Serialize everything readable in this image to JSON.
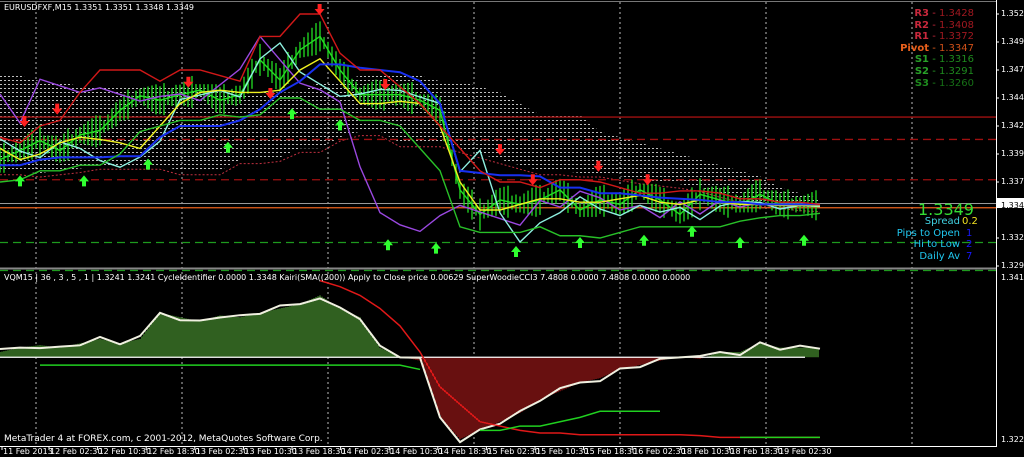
{
  "header": {
    "symbol_line": "EURUSDFXF,M15  1.3351 1.3351 1.3348 1.3349"
  },
  "sub_header": {
    "indicator_line": "VQM15 | 36 , 3 , 5 , 1  |  1.3241 1.3241  CycleIdentifier 0.0000 1.3348  Kairi(SMA((200)) Apply to Close price 0.00629  SuperWoodieCCI3 7.4808 0.0000 7.4808 0.0000 0.0000"
  },
  "footer": {
    "copyright": "MetaTrader 4 at FOREX.com, c 2001-2012, MetaQuotes Software Corp."
  },
  "pivots": [
    {
      "label": "R3",
      "value": "1.3428",
      "color": "#c8283c",
      "vcolor": "#a01820"
    },
    {
      "label": "R2",
      "value": "1.3408",
      "color": "#c8283c",
      "vcolor": "#a01820"
    },
    {
      "label": "R1",
      "value": "1.3372",
      "color": "#c8283c",
      "vcolor": "#a01820"
    },
    {
      "label": "Pivot",
      "value": "1.3347",
      "color": "#e8601c",
      "vcolor": "#d05018"
    },
    {
      "label": "S1",
      "value": "1.3316",
      "color": "#28a028",
      "vcolor": "#1e8a1e"
    },
    {
      "label": "S2",
      "value": "1.3291",
      "color": "#28a028",
      "vcolor": "#1e8a1e"
    },
    {
      "label": "S3",
      "value": "1.3260",
      "color": "#1e8a1e",
      "vcolor": "#167016"
    }
  ],
  "info": {
    "price": "1.3349",
    "spread_label": "Spread",
    "spread_value": "0.2",
    "pips_label": "Pips to Open",
    "pips_value": "1",
    "hilo_label": "Hi to Low",
    "hilo_value": "2",
    "daily_label": "Daily Av",
    "daily_value": "7"
  },
  "chart_data": {
    "type": "line",
    "title": "EURUSDFXF,M15",
    "main_axis": {
      "ylim": [
        1.3283,
        1.3532
      ],
      "ticks": [
        "1.3520",
        "1.3495",
        "1.3470",
        "1.3445",
        "1.3420",
        "1.3395",
        "1.3370",
        "1.3349",
        "1.3320",
        "1.3295"
      ],
      "current": "1.3349"
    },
    "sub_axis": {
      "ylim": [
        1.3222,
        1.3424
      ],
      "ticks": [
        "1.3415",
        "1.3229"
      ]
    },
    "x_step_bars": 13,
    "time_labels": [
      "11 Feb 2013",
      "12 Feb 02:30",
      "12 Feb 10:30",
      "12 Feb 18:30",
      "13 Feb 02:30",
      "13 Feb 10:30",
      "13 Feb 18:30",
      "14 Feb 02:30",
      "14 Feb 10:30",
      "14 Feb 18:30",
      "15 Feb 02:30",
      "15 Feb 10:30",
      "15 Feb 18:30",
      "16 Feb 02:30",
      "18 Feb 10:30",
      "18 Feb 18:30",
      "19 Feb 02:30"
    ],
    "series": [
      {
        "name": "price",
        "color": "#22dd22",
        "values": [
          1.339,
          1.3398,
          1.3407,
          1.3398,
          1.3412,
          1.3416,
          1.3434,
          1.3447,
          1.3443,
          1.3448,
          1.3452,
          1.3443,
          1.3448,
          1.3479,
          1.3461,
          1.3488,
          1.35,
          1.347,
          1.3448,
          1.3448,
          1.3448,
          1.3443,
          1.3434,
          1.3363,
          1.3341,
          1.3354,
          1.335,
          1.3354,
          1.3363,
          1.3345,
          1.3354,
          1.335,
          1.3363,
          1.3354,
          1.3341,
          1.3359,
          1.3354,
          1.335,
          1.3359,
          1.335,
          1.335,
          1.3349
        ]
      },
      {
        "name": "purple",
        "color": "#9a48e0",
        "values": [
          1.3445,
          1.342,
          1.346,
          1.3455,
          1.345,
          1.3455,
          1.345,
          1.3445,
          1.345,
          1.3445,
          1.344,
          1.3455,
          1.347,
          1.35,
          1.348,
          1.346,
          1.3455,
          1.3445,
          1.338,
          1.334,
          1.333,
          1.3325,
          1.334,
          1.335,
          1.3345,
          1.334,
          1.3335,
          1.335,
          1.3345,
          1.336,
          1.3355,
          1.3345,
          1.335,
          1.334,
          1.3355,
          1.3345,
          1.335,
          1.3345,
          1.335,
          1.3345,
          1.335,
          1.3349
        ]
      },
      {
        "name": "cyan",
        "color": "#8ef0e0",
        "values": [
          1.3405,
          1.3395,
          1.339,
          1.3405,
          1.34,
          1.339,
          1.3385,
          1.3395,
          1.341,
          1.344,
          1.3445,
          1.345,
          1.3445,
          1.348,
          1.3495,
          1.347,
          1.346,
          1.345,
          1.3445,
          1.345,
          1.345,
          1.3445,
          1.344,
          1.338,
          1.34,
          1.3345,
          1.332,
          1.333,
          1.334,
          1.3355,
          1.3345,
          1.334,
          1.335,
          1.3345,
          1.335,
          1.334,
          1.3345,
          1.335,
          1.335,
          1.3345,
          1.3349,
          1.3349
        ]
      },
      {
        "name": "yellow",
        "color": "#f0f020",
        "values": [
          1.34,
          1.339,
          1.3395,
          1.3405,
          1.341,
          1.3408,
          1.3405,
          1.34,
          1.342,
          1.344,
          1.345,
          1.3452,
          1.345,
          1.345,
          1.3452,
          1.347,
          1.348,
          1.346,
          1.344,
          1.344,
          1.3442,
          1.344,
          1.342,
          1.337,
          1.3345,
          1.3345,
          1.335,
          1.3355,
          1.3355,
          1.3352,
          1.3352,
          1.3355,
          1.3358,
          1.3352,
          1.335,
          1.3354,
          1.3352,
          1.335,
          1.335,
          1.3349,
          1.3349,
          1.3349
        ]
      },
      {
        "name": "blue",
        "color": "#1830f0",
        "values": [
          1.3385,
          1.3385,
          1.339,
          1.3392,
          1.3392,
          1.3392,
          1.3393,
          1.3393,
          1.341,
          1.342,
          1.342,
          1.342,
          1.3425,
          1.3435,
          1.345,
          1.346,
          1.3475,
          1.3475,
          1.3472,
          1.347,
          1.3468,
          1.346,
          1.344,
          1.338,
          1.3378,
          1.3376,
          1.3376,
          1.3375,
          1.3365,
          1.3365,
          1.336,
          1.336,
          1.3358,
          1.3356,
          1.3355,
          1.3354,
          1.3352,
          1.3352,
          1.335,
          1.335,
          1.335,
          1.335
        ]
      },
      {
        "name": "red",
        "color": "#d01818",
        "values": [
          1.341,
          1.3405,
          1.342,
          1.3425,
          1.345,
          1.347,
          1.347,
          1.347,
          1.346,
          1.347,
          1.347,
          1.3465,
          1.346,
          1.35,
          1.35,
          1.352,
          1.352,
          1.3485,
          1.347,
          1.347,
          1.3455,
          1.344,
          1.342,
          1.34,
          1.338,
          1.337,
          1.337,
          1.3365,
          1.3372,
          1.3372,
          1.337,
          1.3365,
          1.336,
          1.336,
          1.3362,
          1.3362,
          1.336,
          1.3355,
          1.3355,
          1.3352,
          1.3352,
          1.335
        ]
      },
      {
        "name": "green-low",
        "color": "#28c028",
        "values": [
          1.337,
          1.3372,
          1.338,
          1.338,
          1.3385,
          1.3385,
          1.3395,
          1.3415,
          1.342,
          1.3425,
          1.3425,
          1.343,
          1.3428,
          1.343,
          1.3445,
          1.3445,
          1.3435,
          1.3435,
          1.3425,
          1.3425,
          1.342,
          1.34,
          1.338,
          1.333,
          1.3325,
          1.3325,
          1.3325,
          1.333,
          1.3322,
          1.3322,
          1.332,
          1.3325,
          1.333,
          1.333,
          1.333,
          1.333,
          1.333,
          1.3335,
          1.3338,
          1.334,
          1.334,
          1.3342
        ]
      }
    ],
    "levels": [
      {
        "name": "R3",
        "price": 1.3428,
        "color": "#a01010",
        "dash": false
      },
      {
        "name": "R2",
        "price": 1.3408,
        "color": "#a01010",
        "dash": true
      },
      {
        "name": "R1",
        "price": 1.3372,
        "color": "#a01010",
        "dash": true
      },
      {
        "name": "Pivot",
        "price": 1.3347,
        "color": "#e8601c",
        "dash": false
      },
      {
        "name": "S1",
        "price": 1.3316,
        "color": "#1e9a1e",
        "dash": true
      },
      {
        "name": "S2",
        "price": 1.3291,
        "color": "#1e9a1e",
        "dash": true
      }
    ],
    "cloud": {
      "top": [
        1.3465,
        1.3465,
        1.346,
        1.346,
        1.3455,
        1.3455,
        1.3455,
        1.3455,
        1.3455,
        1.3455,
        1.3455,
        1.345,
        1.345,
        1.345,
        1.345,
        1.345,
        1.346,
        1.346,
        1.3465,
        1.3465,
        1.3465,
        1.3465,
        1.346,
        1.346,
        1.3455,
        1.345,
        1.344,
        1.343,
        1.343,
        1.343,
        1.3415,
        1.341,
        1.3405,
        1.34,
        1.3395,
        1.339,
        1.3385,
        1.338,
        1.3375,
        1.3365,
        1.336,
        1.3355
      ],
      "bottom": [
        1.338,
        1.338,
        1.3378,
        1.338,
        1.3382,
        1.3385,
        1.3385,
        1.3385,
        1.3385,
        1.338,
        1.338,
        1.338,
        1.339,
        1.339,
        1.3392,
        1.34,
        1.34,
        1.341,
        1.3415,
        1.3415,
        1.3405,
        1.3405,
        1.3405,
        1.34,
        1.3395,
        1.339,
        1.3385,
        1.338,
        1.338,
        1.3378,
        1.3378,
        1.3375,
        1.3372,
        1.337,
        1.3368,
        1.3365,
        1.336,
        1.3355,
        1.3352,
        1.335,
        1.3348,
        1.3347
      ]
    },
    "arrows_down": [
      [
        1,
        1.342
      ],
      [
        3,
        1.3431
      ],
      [
        11,
        1.3455
      ],
      [
        16,
        1.3445
      ],
      [
        19,
        1.352
      ],
      [
        23,
        1.3453
      ],
      [
        30,
        1.3395
      ],
      [
        32,
        1.3368
      ],
      [
        36,
        1.338
      ],
      [
        39,
        1.3368
      ]
    ],
    "arrows_up": [
      [
        1,
        1.3375
      ],
      [
        5,
        1.3375
      ],
      [
        9,
        1.339
      ],
      [
        14,
        1.3405
      ],
      [
        18,
        1.3435
      ],
      [
        21,
        1.3425
      ],
      [
        24,
        1.3318
      ],
      [
        27,
        1.3315
      ],
      [
        32,
        1.3312
      ],
      [
        36,
        1.332
      ],
      [
        40,
        1.3322
      ],
      [
        43,
        1.333
      ],
      [
        46,
        1.332
      ],
      [
        50,
        1.3322
      ]
    ],
    "sub_series": [
      {
        "name": "white",
        "color": "#f0f0e0",
        "values": [
          1.333,
          1.3335,
          1.3338,
          1.3335,
          1.334,
          1.3345,
          1.334,
          1.3345,
          1.3375,
          1.337,
          1.3365,
          1.3372,
          1.337,
          1.3375,
          1.338,
          1.3385,
          1.3395,
          1.338,
          1.337,
          1.3335,
          1.3325,
          1.332,
          1.3255,
          1.323,
          1.324,
          1.325,
          1.326,
          1.3275,
          1.3285,
          1.3295,
          1.33,
          1.331,
          1.3315,
          1.332,
          1.3325,
          1.3322,
          1.333,
          1.333,
          1.334,
          1.3335,
          1.3335,
          1.3335
        ]
      },
      {
        "name": "red",
        "color": "#e01818",
        "values": [
          null,
          null,
          null,
          null,
          null,
          null,
          null,
          null,
          null,
          null,
          null,
          null,
          null,
          null,
          null,
          null,
          1.3412,
          1.3405,
          1.3395,
          1.338,
          1.336,
          1.333,
          1.329,
          1.327,
          1.325,
          1.3245,
          1.324,
          1.3237,
          1.3237,
          1.3235,
          1.3235,
          1.3235,
          1.3235,
          1.3235,
          1.3235,
          1.3234,
          1.3232,
          1.3232,
          1.3232,
          1.3232,
          1.3232,
          1.3232
        ]
      },
      {
        "name": "green",
        "color": "#20d020",
        "values": [
          null,
          null,
          1.3315,
          1.3315,
          1.3315,
          1.3315,
          1.3315,
          1.3315,
          1.3315,
          1.3315,
          1.3315,
          1.3315,
          1.3315,
          1.3315,
          1.3315,
          1.3315,
          1.3315,
          1.3315,
          1.3315,
          1.3315,
          1.3315,
          1.331,
          null,
          null,
          1.324,
          1.324,
          1.3245,
          1.3245,
          1.325,
          1.3255,
          1.3262,
          1.3262,
          1.3262,
          1.3262,
          null,
          null,
          null,
          1.3232,
          1.3232,
          1.3232,
          1.3232,
          1.3232
        ]
      }
    ],
    "sub_baseline": 1.3324
  }
}
